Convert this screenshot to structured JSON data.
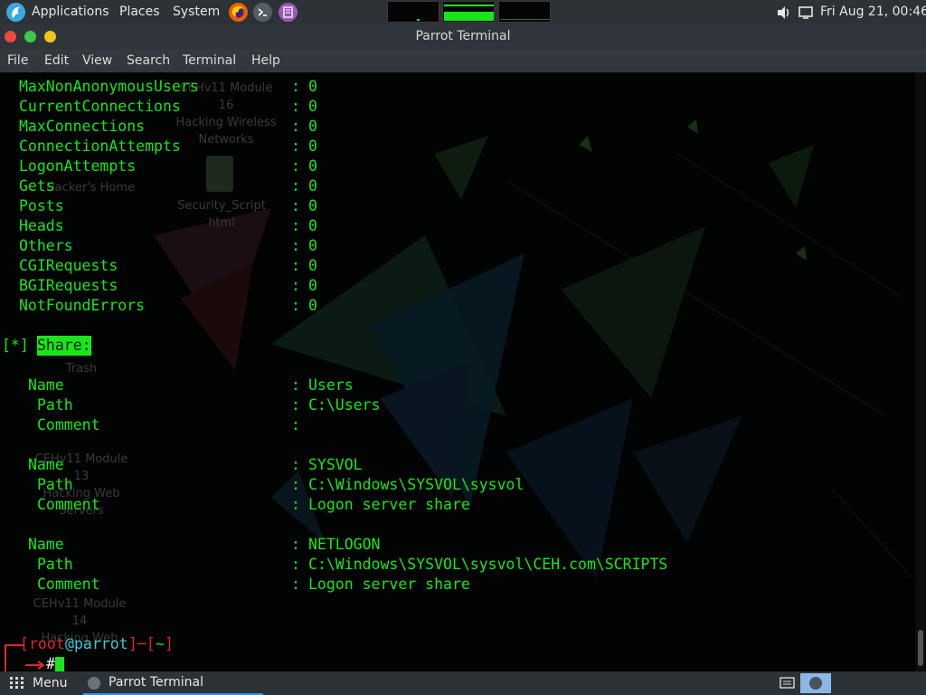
{
  "top_panel": {
    "applications_label": "Applications",
    "places_label": "Places",
    "system_label": "System",
    "launchers": [
      {
        "name": "firefox-icon",
        "color": "#e66000"
      },
      {
        "name": "terminal-icon",
        "color": "#555d66"
      },
      {
        "name": "text-editor-icon",
        "color": "#9b59b6"
      }
    ],
    "clock": "Fri Aug 21, 00:46"
  },
  "window": {
    "title": "Parrot Terminal"
  },
  "menubar": {
    "items": [
      "File",
      "Edit",
      "View",
      "Search",
      "Terminal",
      "Help"
    ]
  },
  "terminal": {
    "stats": [
      {
        "key": "MaxNonAnonymousUsers",
        "value": "0"
      },
      {
        "key": "CurrentConnections",
        "value": "0"
      },
      {
        "key": "MaxConnections",
        "value": "0"
      },
      {
        "key": "ConnectionAttempts",
        "value": "0"
      },
      {
        "key": "LogonAttempts",
        "value": "0"
      },
      {
        "key": "Gets",
        "value": "0"
      },
      {
        "key": "Posts",
        "value": "0"
      },
      {
        "key": "Heads",
        "value": "0"
      },
      {
        "key": "Others",
        "value": "0"
      },
      {
        "key": "CGIRequests",
        "value": "0"
      },
      {
        "key": "BGIRequests",
        "value": "0"
      },
      {
        "key": "NotFoundErrors",
        "value": "0"
      }
    ],
    "share_marker": "[*]",
    "share_heading": "Share:",
    "shares": [
      {
        "name": "Users",
        "path": "C:\\Users",
        "comment": ""
      },
      {
        "name": "SYSVOL",
        "path": "C:\\Windows\\SYSVOL\\sysvol",
        "comment": "Logon server share"
      },
      {
        "name": "NETLOGON",
        "path": "C:\\Windows\\SYSVOL\\sysvol\\CEH.com\\SCRIPTS",
        "comment": "Logon server share"
      }
    ],
    "field_labels": {
      "name": "Name",
      "path": "Path",
      "comment": "Comment"
    },
    "separator": ":",
    "prompt": {
      "user": "root",
      "host": "parrot",
      "dir": "~",
      "symbol": "#"
    }
  },
  "desktop_labels": [
    "CEHv11 Module 16\nHacking Wireless\nNetworks",
    "Hacker's Home",
    "Security_Script\nhtml",
    "Trash",
    "CEHv11 Module 13\nHacking Web\nServers",
    "CEHv11 Module 14\nHacking Web"
  ],
  "bottom_panel": {
    "menu_label": "Menu",
    "task_label": "Parrot Terminal"
  }
}
